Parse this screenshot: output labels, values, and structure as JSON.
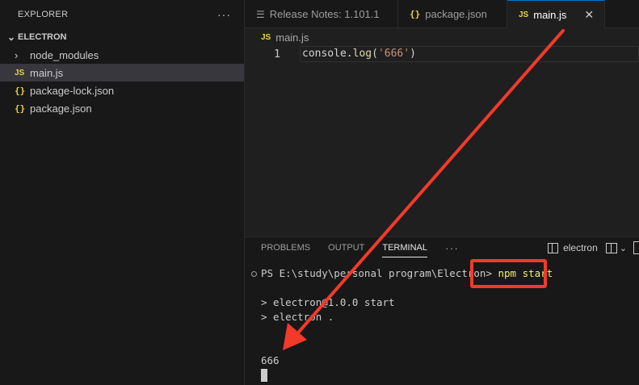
{
  "sidebar": {
    "title": "EXPLORER",
    "more": "···",
    "folder": "ELECTRON",
    "items": [
      {
        "label": "node_modules",
        "icon": "chevron-right-icon"
      },
      {
        "label": "main.js",
        "icon": "javascript-file-icon",
        "badge": "JS",
        "selected": true
      },
      {
        "label": "package-lock.json",
        "icon": "json-file-icon",
        "badge": "{}"
      },
      {
        "label": "package.json",
        "icon": "json-file-icon",
        "badge": "{}"
      }
    ]
  },
  "tabs": [
    {
      "label": "Release Notes: 1.101.1",
      "icon": "release-notes-icon"
    },
    {
      "label": "package.json",
      "icon": "json-file-icon",
      "badge": "{}"
    },
    {
      "label": "main.js",
      "icon": "javascript-file-icon",
      "badge": "JS",
      "active": true,
      "close": "✕"
    }
  ],
  "editor": {
    "breadcrumb_badge": "JS",
    "breadcrumb": "main.js",
    "line_number": "1",
    "code": {
      "obj": "console.",
      "fn": "log",
      "open": "(",
      "str": "'666'",
      "close": ")"
    }
  },
  "panel": {
    "tabs": [
      "PROBLEMS",
      "OUTPUT",
      "TERMINAL"
    ],
    "active_tab": "TERMINAL",
    "more": "···",
    "terminal_name": "electron",
    "lines": {
      "prompt": "PS E:\\study\\personal program\\Electron> ",
      "command": "npm start",
      "out1": "> electron@1.0.0 start",
      "out2": "> electron .",
      "out3": "666"
    }
  },
  "colors": {
    "accent": "#0078d4",
    "annotation": "#f23a2a",
    "js_badge": "#e8d44d"
  }
}
